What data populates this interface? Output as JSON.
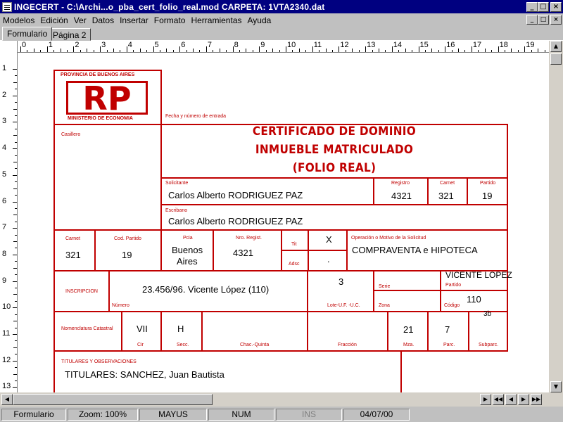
{
  "window": {
    "title": "INGECERT - C:\\Archi...o_pba_cert_folio_real.mod   CARPETA: 1VTA2340.dat",
    "buttons": {
      "minimize": "_",
      "maximize": "□",
      "close": "×"
    }
  },
  "menubar": {
    "items": [
      "Modelos",
      "Edición",
      "Ver",
      "Datos",
      "Insertar",
      "Formato",
      "Herramientas",
      "Ayuda"
    ]
  },
  "tabs": [
    {
      "label": "Formulario",
      "active": true
    },
    {
      "label": "Página 2",
      "active": false
    }
  ],
  "ruler": {
    "h_numbers": [
      "0",
      "1",
      "2",
      "3",
      "4",
      "5",
      "6",
      "7",
      "8",
      "9",
      "10",
      "11",
      "12",
      "13",
      "14",
      "15",
      "16",
      "17",
      "18",
      "19"
    ],
    "v_numbers": [
      "1",
      "2",
      "3",
      "4",
      "5",
      "6",
      "7",
      "8",
      "9",
      "10",
      "11",
      "12",
      "13"
    ]
  },
  "form": {
    "logo": {
      "top_text": "PROVINCIA DE BUENOS AIRES",
      "letters": "RP",
      "bottom_text": "MINISTERIO DE ECONOMIA"
    },
    "entry_label": "Fecha y número de entrada",
    "casillero_label": "Casillero",
    "title_lines": [
      "CERTIFICADO DE DOMINIO",
      "INMUEBLE MATRICULADO",
      "(FOLIO REAL)"
    ],
    "solicitante": {
      "label": "Solicitante",
      "value": "Carlos Alberto RODRIGUEZ PAZ"
    },
    "registro": {
      "label": "Registro",
      "value": "4321"
    },
    "carnet_top": {
      "label": "Carnet",
      "value": "321"
    },
    "partido_top": {
      "label": "Partido",
      "value": "19"
    },
    "escribano": {
      "label": "Escribano",
      "value": "Carlos Alberto RODRIGUEZ PAZ"
    },
    "row3": {
      "carnet": {
        "label": "Carnet",
        "value": "321"
      },
      "cod_partido": {
        "label": "Cod. Partido",
        "value": "19"
      },
      "pcia": {
        "label": "Pcia",
        "value_line1": "Buenos",
        "value_line2": "Aires"
      },
      "nro_regist": {
        "label": "Nro. Regist.",
        "value": "4321"
      },
      "tit": {
        "label": "Tit",
        "value": "X"
      },
      "adsc": {
        "label": "Adsc",
        "value": "."
      },
      "operacion": {
        "label": "Operación o Motivo de la Solicitud",
        "value": "COMPRAVENTA e HIPOTECA"
      }
    },
    "row4": {
      "inscripcion_label": "INSCRIPCION",
      "numero": {
        "label": "Número",
        "value": "23.456/96. Vicente López (110)"
      },
      "lote": {
        "label": "Lote-U.F. -U.C.",
        "value": "3"
      },
      "serie_label": "Serie",
      "zona_label": "Zona",
      "partido": {
        "label": "Partido",
        "value": "VICENTE LOPEZ"
      },
      "codigo": {
        "label": "Código",
        "value": "110"
      }
    },
    "row5": {
      "nomenclatura_label": "Nomenclatura Catastral",
      "cir": {
        "label": "Cir",
        "value": "VII"
      },
      "secc": {
        "label": "Secc.",
        "value": "H"
      },
      "chac_quinta": {
        "label": "Chac.-Quinta",
        "value": ""
      },
      "fraccion": {
        "label": "Fracción",
        "value": ""
      },
      "mza": {
        "label": "Mza.",
        "value": "21"
      },
      "parc": {
        "label": "Parc.",
        "value": "7"
      },
      "subparc": {
        "label": "Subparc.",
        "value": "3b"
      }
    },
    "titulares": {
      "label": "TITULARES Y OBSERVACIONES",
      "value": "TITULARES: SANCHEZ, Juan Bautista"
    }
  },
  "statusbar": {
    "panels": [
      "Formulario",
      "Zoom:  100%",
      "MAYUS",
      "NUM",
      "INS",
      "04/07/00"
    ]
  },
  "colors": {
    "form_red": "#c00000",
    "titlebar": "#000080",
    "chrome": "#c0c0c0"
  }
}
